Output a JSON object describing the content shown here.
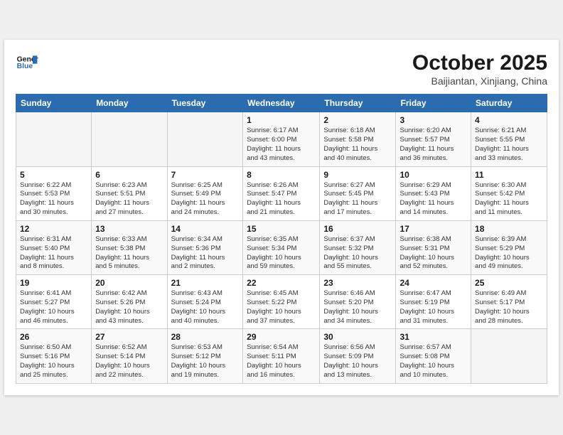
{
  "header": {
    "logo_line1": "General",
    "logo_line2": "Blue",
    "month": "October 2025",
    "location": "Baijiantan, Xinjiang, China"
  },
  "weekdays": [
    "Sunday",
    "Monday",
    "Tuesday",
    "Wednesday",
    "Thursday",
    "Friday",
    "Saturday"
  ],
  "weeks": [
    [
      {
        "day": "",
        "info": ""
      },
      {
        "day": "",
        "info": ""
      },
      {
        "day": "",
        "info": ""
      },
      {
        "day": "1",
        "info": "Sunrise: 6:17 AM\nSunset: 6:00 PM\nDaylight: 11 hours\nand 43 minutes."
      },
      {
        "day": "2",
        "info": "Sunrise: 6:18 AM\nSunset: 5:58 PM\nDaylight: 11 hours\nand 40 minutes."
      },
      {
        "day": "3",
        "info": "Sunrise: 6:20 AM\nSunset: 5:57 PM\nDaylight: 11 hours\nand 36 minutes."
      },
      {
        "day": "4",
        "info": "Sunrise: 6:21 AM\nSunset: 5:55 PM\nDaylight: 11 hours\nand 33 minutes."
      }
    ],
    [
      {
        "day": "5",
        "info": "Sunrise: 6:22 AM\nSunset: 5:53 PM\nDaylight: 11 hours\nand 30 minutes."
      },
      {
        "day": "6",
        "info": "Sunrise: 6:23 AM\nSunset: 5:51 PM\nDaylight: 11 hours\nand 27 minutes."
      },
      {
        "day": "7",
        "info": "Sunrise: 6:25 AM\nSunset: 5:49 PM\nDaylight: 11 hours\nand 24 minutes."
      },
      {
        "day": "8",
        "info": "Sunrise: 6:26 AM\nSunset: 5:47 PM\nDaylight: 11 hours\nand 21 minutes."
      },
      {
        "day": "9",
        "info": "Sunrise: 6:27 AM\nSunset: 5:45 PM\nDaylight: 11 hours\nand 17 minutes."
      },
      {
        "day": "10",
        "info": "Sunrise: 6:29 AM\nSunset: 5:43 PM\nDaylight: 11 hours\nand 14 minutes."
      },
      {
        "day": "11",
        "info": "Sunrise: 6:30 AM\nSunset: 5:42 PM\nDaylight: 11 hours\nand 11 minutes."
      }
    ],
    [
      {
        "day": "12",
        "info": "Sunrise: 6:31 AM\nSunset: 5:40 PM\nDaylight: 11 hours\nand 8 minutes."
      },
      {
        "day": "13",
        "info": "Sunrise: 6:33 AM\nSunset: 5:38 PM\nDaylight: 11 hours\nand 5 minutes."
      },
      {
        "day": "14",
        "info": "Sunrise: 6:34 AM\nSunset: 5:36 PM\nDaylight: 11 hours\nand 2 minutes."
      },
      {
        "day": "15",
        "info": "Sunrise: 6:35 AM\nSunset: 5:34 PM\nDaylight: 10 hours\nand 59 minutes."
      },
      {
        "day": "16",
        "info": "Sunrise: 6:37 AM\nSunset: 5:32 PM\nDaylight: 10 hours\nand 55 minutes."
      },
      {
        "day": "17",
        "info": "Sunrise: 6:38 AM\nSunset: 5:31 PM\nDaylight: 10 hours\nand 52 minutes."
      },
      {
        "day": "18",
        "info": "Sunrise: 6:39 AM\nSunset: 5:29 PM\nDaylight: 10 hours\nand 49 minutes."
      }
    ],
    [
      {
        "day": "19",
        "info": "Sunrise: 6:41 AM\nSunset: 5:27 PM\nDaylight: 10 hours\nand 46 minutes."
      },
      {
        "day": "20",
        "info": "Sunrise: 6:42 AM\nSunset: 5:26 PM\nDaylight: 10 hours\nand 43 minutes."
      },
      {
        "day": "21",
        "info": "Sunrise: 6:43 AM\nSunset: 5:24 PM\nDaylight: 10 hours\nand 40 minutes."
      },
      {
        "day": "22",
        "info": "Sunrise: 6:45 AM\nSunset: 5:22 PM\nDaylight: 10 hours\nand 37 minutes."
      },
      {
        "day": "23",
        "info": "Sunrise: 6:46 AM\nSunset: 5:20 PM\nDaylight: 10 hours\nand 34 minutes."
      },
      {
        "day": "24",
        "info": "Sunrise: 6:47 AM\nSunset: 5:19 PM\nDaylight: 10 hours\nand 31 minutes."
      },
      {
        "day": "25",
        "info": "Sunrise: 6:49 AM\nSunset: 5:17 PM\nDaylight: 10 hours\nand 28 minutes."
      }
    ],
    [
      {
        "day": "26",
        "info": "Sunrise: 6:50 AM\nSunset: 5:16 PM\nDaylight: 10 hours\nand 25 minutes."
      },
      {
        "day": "27",
        "info": "Sunrise: 6:52 AM\nSunset: 5:14 PM\nDaylight: 10 hours\nand 22 minutes."
      },
      {
        "day": "28",
        "info": "Sunrise: 6:53 AM\nSunset: 5:12 PM\nDaylight: 10 hours\nand 19 minutes."
      },
      {
        "day": "29",
        "info": "Sunrise: 6:54 AM\nSunset: 5:11 PM\nDaylight: 10 hours\nand 16 minutes."
      },
      {
        "day": "30",
        "info": "Sunrise: 6:56 AM\nSunset: 5:09 PM\nDaylight: 10 hours\nand 13 minutes."
      },
      {
        "day": "31",
        "info": "Sunrise: 6:57 AM\nSunset: 5:08 PM\nDaylight: 10 hours\nand 10 minutes."
      },
      {
        "day": "",
        "info": ""
      }
    ]
  ]
}
